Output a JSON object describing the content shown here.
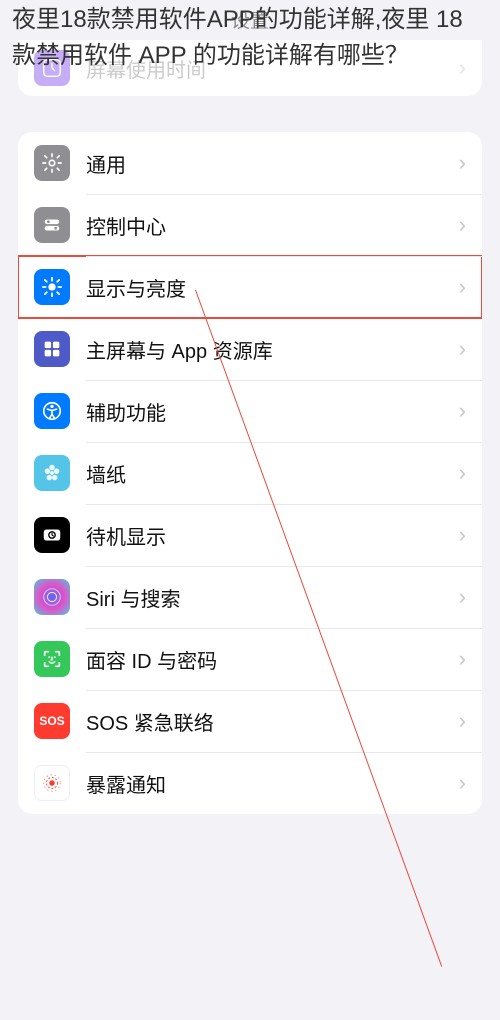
{
  "overlay": "夜里18款禁用软件APP的功能详解,夜里 18 款禁用软件 APP 的功能详解有哪些？",
  "header": {
    "title": "设置"
  },
  "prev_group": {
    "item": {
      "label": "屏幕使用时间"
    }
  },
  "settings_group": {
    "items": [
      {
        "id": "general",
        "label": "通用"
      },
      {
        "id": "control",
        "label": "控制中心"
      },
      {
        "id": "display",
        "label": "显示与亮度",
        "highlighted": true
      },
      {
        "id": "home",
        "label": "主屏幕与 App 资源库"
      },
      {
        "id": "accessibility",
        "label": "辅助功能"
      },
      {
        "id": "wallpaper",
        "label": "墙纸"
      },
      {
        "id": "standby",
        "label": "待机显示"
      },
      {
        "id": "siri",
        "label": "Siri 与搜索"
      },
      {
        "id": "faceid",
        "label": "面容 ID 与密码"
      },
      {
        "id": "sos",
        "label": "SOS 紧急联络",
        "text_icon": "SOS"
      },
      {
        "id": "exposure",
        "label": "暴露通知"
      }
    ]
  },
  "colors": {
    "highlight": "#e74c3c",
    "bg": "#f2f2f7",
    "card": "#ffffff"
  }
}
